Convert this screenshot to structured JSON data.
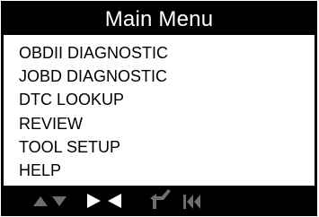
{
  "header": {
    "title": "Main Menu"
  },
  "menu": {
    "items": [
      {
        "label": "OBDII DIAGNOSTIC"
      },
      {
        "label": "JOBD DIAGNOSTIC"
      },
      {
        "label": "DTC LOOKUP"
      },
      {
        "label": "REVIEW"
      },
      {
        "label": "TOOL SETUP"
      },
      {
        "label": "HELP"
      }
    ]
  },
  "toolbar": {
    "icons": [
      "up-down-arrows-icon",
      "right-left-arrows-icon",
      "enter-return-icon",
      "back-first-icon"
    ],
    "colors": {
      "bar": "#000000",
      "active": "#ffffff",
      "inactive": "#6e6e6e"
    }
  }
}
